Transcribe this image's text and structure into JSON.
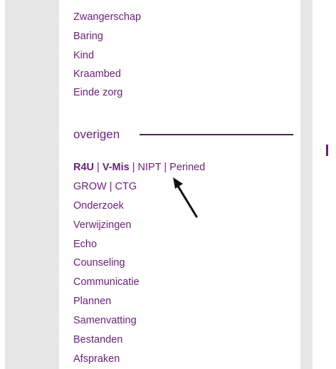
{
  "nav": {
    "top_links": [
      "Zwangerschap",
      "Baring",
      "Kind",
      "Kraambed",
      "Einde zorg"
    ],
    "section_title": "overigen",
    "row1": {
      "r4u": "R4U",
      "vmis": "V-Mis",
      "nipt": "NIPT",
      "perined": "Perined",
      "sep": "|"
    },
    "row2": {
      "grow": "GROW",
      "ctg": "CTG",
      "sep": "|"
    },
    "links": [
      "Onderzoek",
      "Verwijzingen",
      "Echo",
      "Counseling",
      "Communicatie",
      "Plannen",
      "Samenvatting",
      "Bestanden",
      "Afspraken"
    ]
  },
  "colors": {
    "link": "#6b1f7a",
    "rule": "#5a1868",
    "gutter": "#e6e6e6"
  },
  "icons": {
    "pointer": "arrow-pointer-icon"
  }
}
